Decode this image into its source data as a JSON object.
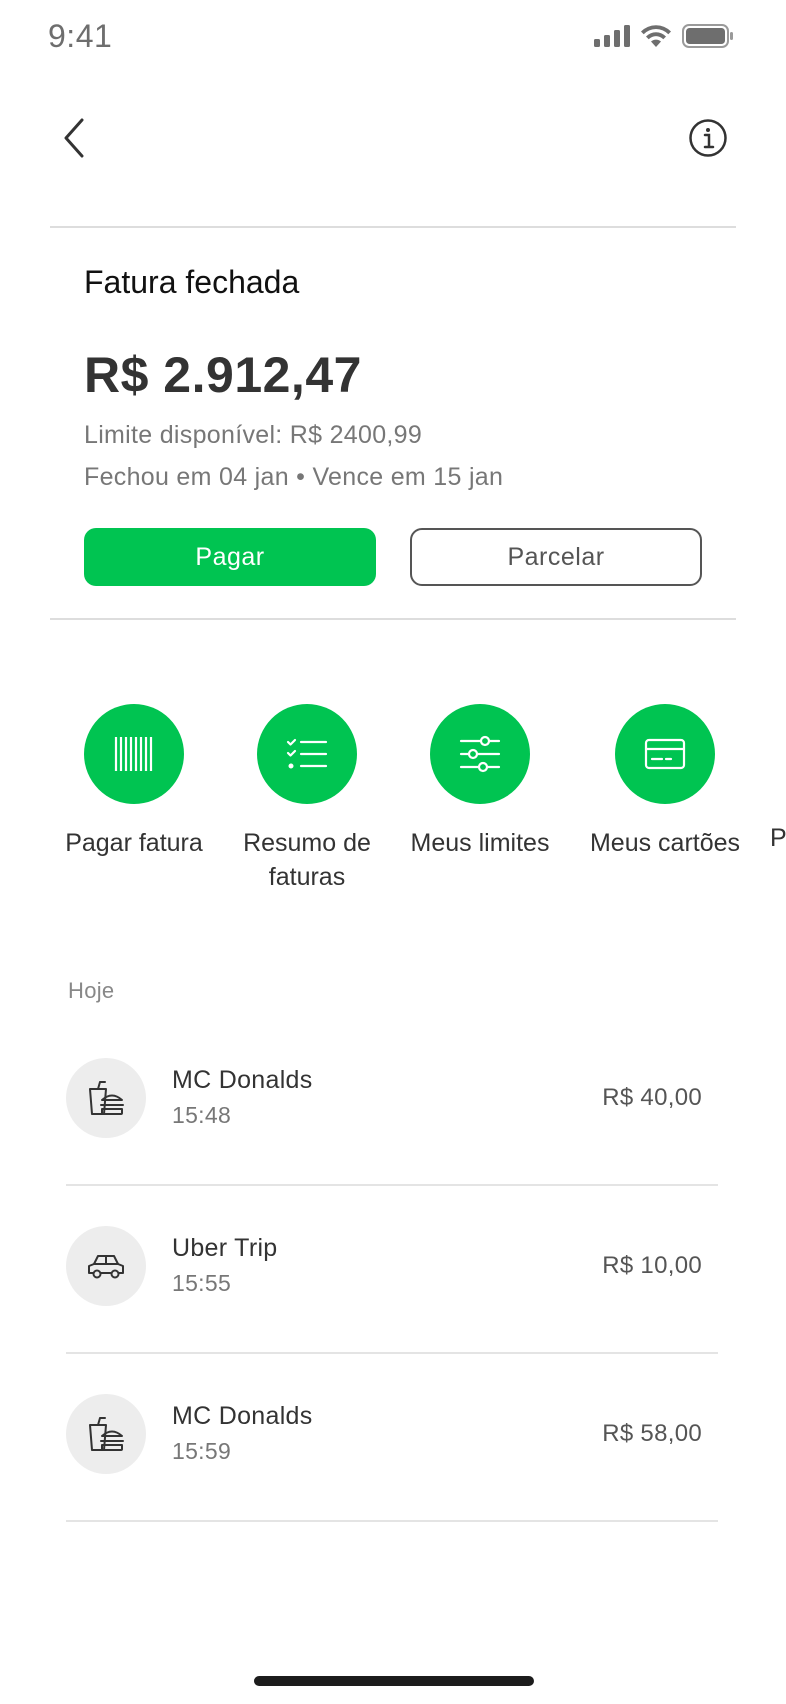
{
  "status_bar": {
    "time": "9:41",
    "icons": [
      "cellular-signal-icon",
      "wifi-icon",
      "battery-icon"
    ]
  },
  "nav": {
    "back_icon": "chevron-left-icon",
    "info_icon": "info-icon"
  },
  "bill": {
    "title": "Fatura fechada",
    "amount": "R$ 2.912,47",
    "limit_text": "Limite disponível: R$ 2400,99",
    "dates_text": "Fechou em 04 jan • Vence em 15 jan"
  },
  "actions": {
    "pay_label": "Pagar",
    "installments_label": "Parcelar"
  },
  "shortcuts": [
    {
      "label": "Pagar fatura",
      "icon": "barcode-icon"
    },
    {
      "label": "Resumo de faturas",
      "icon": "checklist-icon"
    },
    {
      "label": "Meus limites",
      "icon": "sliders-icon"
    },
    {
      "label": "Meus cartões",
      "icon": "credit-card-icon"
    },
    {
      "label": "P",
      "icon": ""
    }
  ],
  "transactions_section": {
    "label": "Hoje",
    "items": [
      {
        "name": "MC Donalds",
        "time": "15:48",
        "amount": "R$ 40,00",
        "icon": "fast-food-icon"
      },
      {
        "name": "Uber Trip",
        "time": "15:55",
        "amount": "R$ 10,00",
        "icon": "car-icon"
      },
      {
        "name": "MC Donalds",
        "time": "15:59",
        "amount": "R$ 58,00",
        "icon": "fast-food-icon"
      }
    ]
  },
  "colors": {
    "accent": "#00c451",
    "text_primary": "#333333",
    "text_secondary": "#777777"
  }
}
